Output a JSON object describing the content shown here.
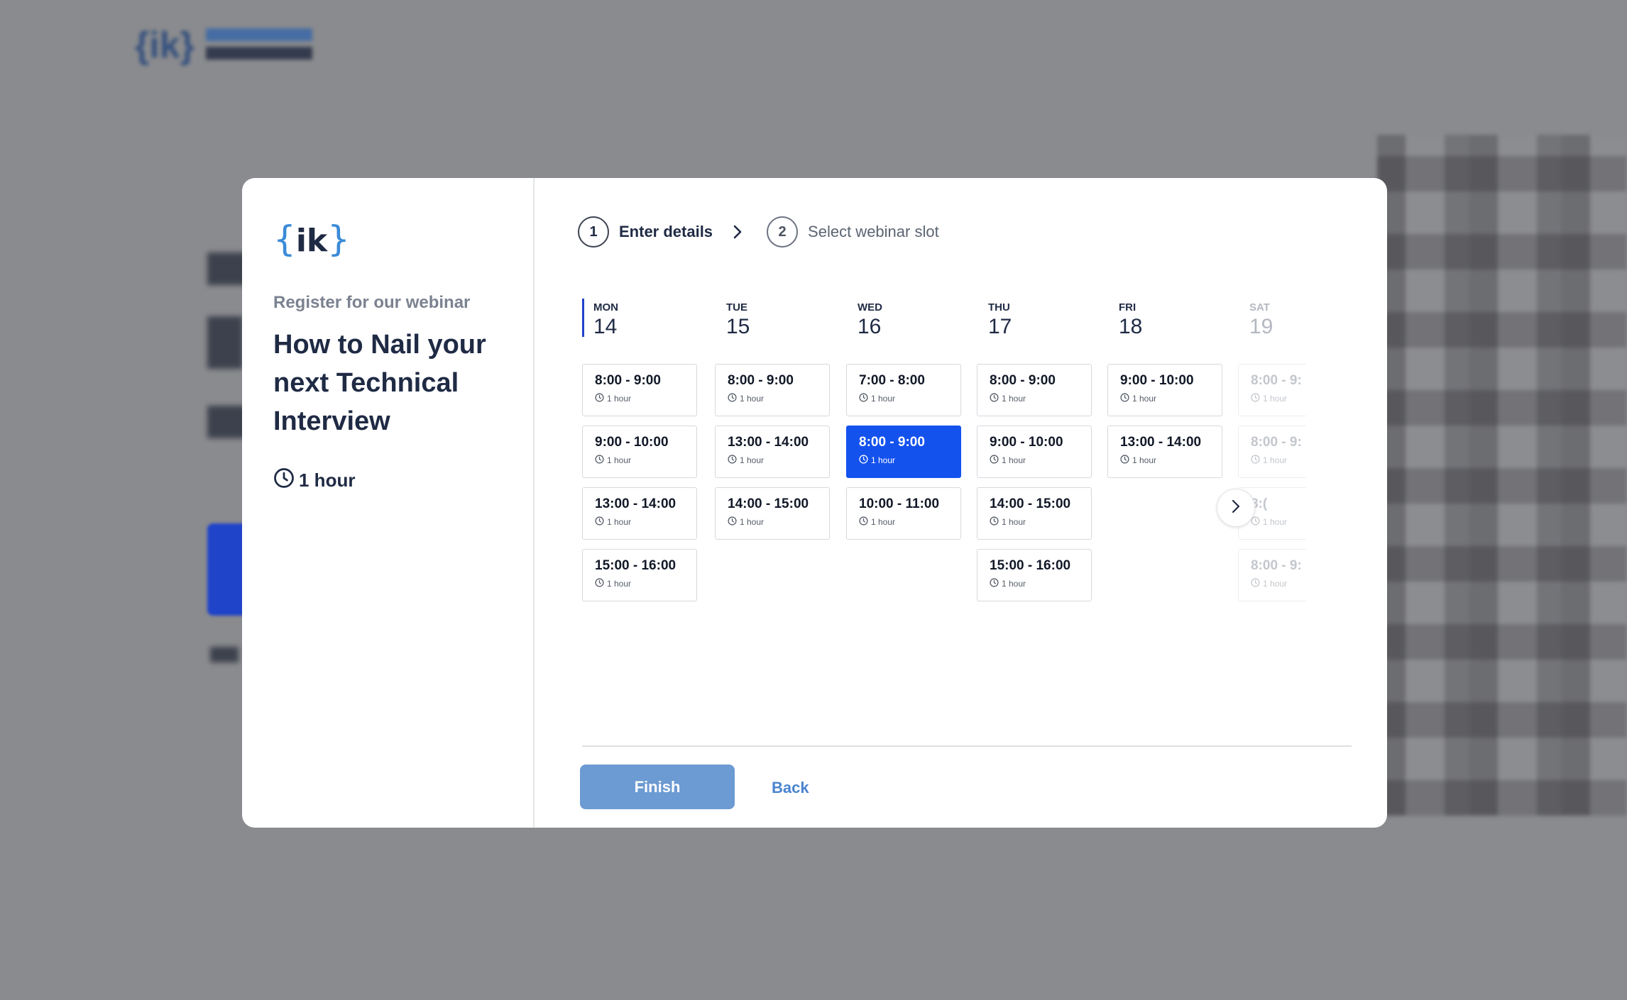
{
  "colors": {
    "selected_slot": "#1452ee",
    "finish_button": "#6c9ad2",
    "back_link": "#4a84cf",
    "logo_brace": "#3b8bd8",
    "text_dark": "#1f2a44"
  },
  "logo": {
    "open_brace": "{",
    "letters": "ik",
    "close_brace": "}"
  },
  "left": {
    "register_label": "Register for our webinar",
    "title": "How to Nail your next Technical Interview",
    "duration": "1 hour"
  },
  "steps": [
    {
      "number": "1",
      "label": "Enter details"
    },
    {
      "number": "2",
      "label": "Select webinar slot"
    }
  ],
  "calendar": {
    "days": [
      {
        "name": "MON",
        "date": "14",
        "slots": [
          {
            "time": "8:00 - 9:00",
            "duration": "1 hour"
          },
          {
            "time": "9:00 - 10:00",
            "duration": "1 hour"
          },
          {
            "time": "13:00 - 14:00",
            "duration": "1 hour"
          },
          {
            "time": "15:00 - 16:00",
            "duration": "1 hour"
          }
        ]
      },
      {
        "name": "TUE",
        "date": "15",
        "slots": [
          {
            "time": "8:00 - 9:00",
            "duration": "1 hour"
          },
          {
            "time": "13:00 - 14:00",
            "duration": "1 hour"
          },
          {
            "time": "14:00 - 15:00",
            "duration": "1 hour"
          }
        ]
      },
      {
        "name": "WED",
        "date": "16",
        "slots": [
          {
            "time": "7:00 - 8:00",
            "duration": "1 hour"
          },
          {
            "time": "8:00 - 9:00",
            "duration": "1 hour",
            "selected": true
          },
          {
            "time": "10:00 - 11:00",
            "duration": "1 hour"
          }
        ]
      },
      {
        "name": "THU",
        "date": "17",
        "slots": [
          {
            "time": "8:00 - 9:00",
            "duration": "1 hour"
          },
          {
            "time": "9:00 - 10:00",
            "duration": "1 hour"
          },
          {
            "time": "14:00 - 15:00",
            "duration": "1 hour"
          },
          {
            "time": "15:00 - 16:00",
            "duration": "1 hour"
          }
        ]
      },
      {
        "name": "FRI",
        "date": "18",
        "slots": [
          {
            "time": "9:00 - 10:00",
            "duration": "1 hour"
          },
          {
            "time": "13:00 - 14:00",
            "duration": "1 hour"
          }
        ]
      },
      {
        "name": "SAT",
        "date": "19",
        "faded": true,
        "slots": [
          {
            "time": "8:00 - 9:",
            "duration": "1 hour"
          },
          {
            "time": "8:00 - 9:",
            "duration": "1 hour"
          },
          {
            "time": "8:(",
            "duration": "1 hour"
          },
          {
            "time": "8:00 - 9:",
            "duration": "1 hour"
          }
        ]
      }
    ]
  },
  "actions": {
    "finish_label": "Finish",
    "back_label": "Back"
  }
}
